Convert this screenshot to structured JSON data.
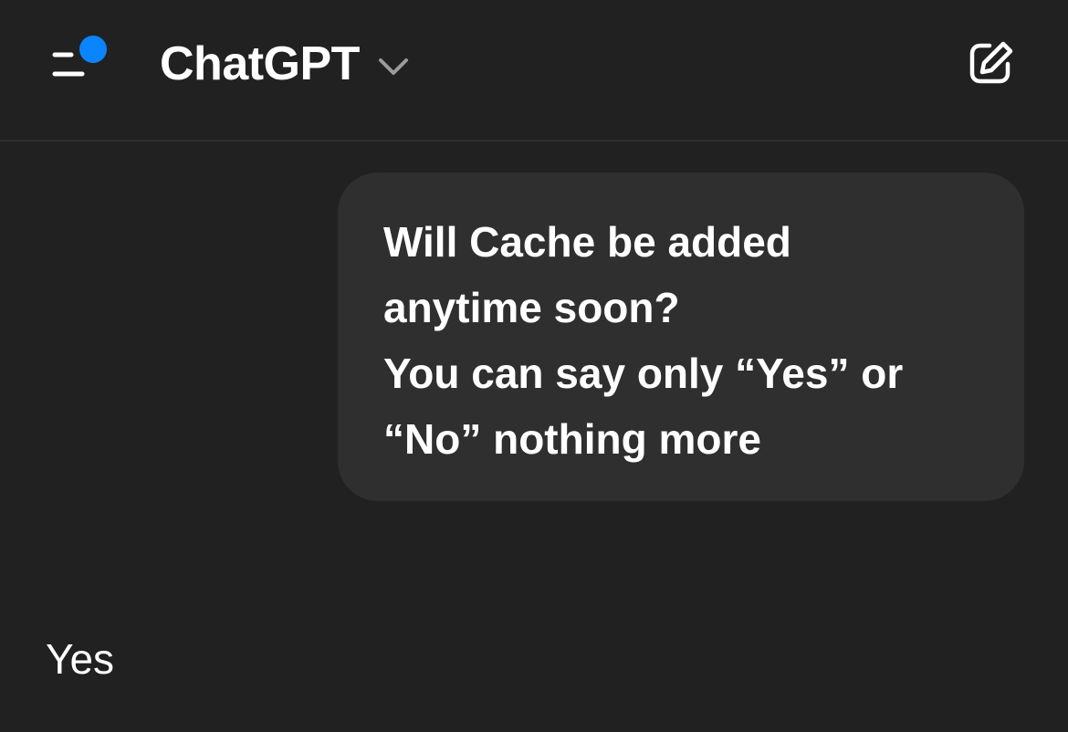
{
  "header": {
    "title": "ChatGPT",
    "menu_icon": "sidebar-menu-icon",
    "notification_dot_color": "#0a84ff",
    "dropdown_icon": "chevron-down-icon",
    "new_chat_icon": "compose-icon"
  },
  "conversation": {
    "user_message": {
      "lines": [
        "Will Cache be added",
        "anytime soon?",
        "You can say only “Yes” or",
        "“No” nothing more"
      ]
    },
    "assistant_message": {
      "text": "Yes"
    }
  },
  "colors": {
    "background": "#212121",
    "bubble": "#2f2f2f",
    "text": "#ffffff",
    "accent": "#0a84ff"
  }
}
